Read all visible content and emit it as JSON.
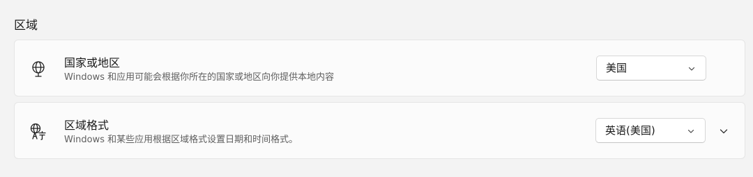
{
  "section": {
    "title": "区域"
  },
  "region": {
    "icon": "globe-icon",
    "title": "国家或地区",
    "description": "Windows 和应用可能会根据你所在的国家或地区向你提供本地内容",
    "selected_value": "美国"
  },
  "format": {
    "icon": "language-format-icon",
    "title": "区域格式",
    "description": "Windows 和某些应用根据区域格式设置日期和时间格式。",
    "selected_value": "英语(美国)",
    "expand_icon": "chevron-down-icon"
  },
  "colors": {
    "background": "#f3f3f3",
    "card": "#fbfbfb",
    "secondary_text": "#5f5f5f"
  }
}
